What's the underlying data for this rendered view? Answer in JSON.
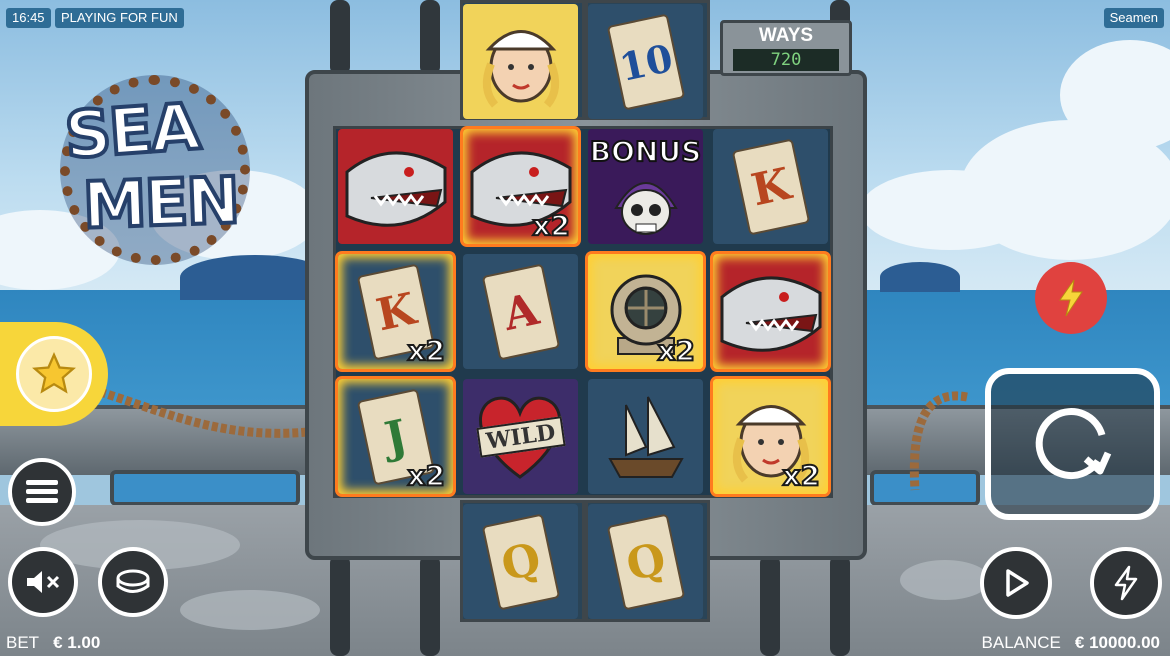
{
  "topbar": {
    "time": "16:45",
    "mode": "PLAYING FOR FUN",
    "game_name": "Seamen"
  },
  "logo": {
    "line1": "SEA",
    "line2": "MEN"
  },
  "ways": {
    "label": "WAYS",
    "value": "720"
  },
  "reels": {
    "top_row": [
      {
        "symbol": "sailor-girl"
      },
      {
        "symbol": "card",
        "text": "10",
        "color": "#1f4f9a"
      }
    ],
    "rows": [
      [
        {
          "symbol": "shark"
        },
        {
          "symbol": "shark",
          "win": true,
          "multiplier": "x2"
        },
        {
          "symbol": "bonus",
          "text": "BONUS"
        },
        {
          "symbol": "card",
          "text": "K",
          "color": "#b8461f"
        }
      ],
      [
        {
          "symbol": "card",
          "text": "K",
          "color": "#b8461f",
          "win": true,
          "multiplier": "x2"
        },
        {
          "symbol": "card",
          "text": "A",
          "color": "#b02a2a"
        },
        {
          "symbol": "diving-helmet",
          "win": true,
          "multiplier": "x2"
        },
        {
          "symbol": "shark",
          "win": true
        }
      ],
      [
        {
          "symbol": "card",
          "text": "J",
          "color": "#2f7a37",
          "win": true,
          "multiplier": "x2"
        },
        {
          "symbol": "wild-heart",
          "text": "WILD"
        },
        {
          "symbol": "ship"
        },
        {
          "symbol": "sailor-girl",
          "win": true,
          "multiplier": "x2"
        }
      ]
    ],
    "bottom_row": [
      {
        "symbol": "card",
        "text": "Q",
        "color": "#c9981b"
      },
      {
        "symbol": "card",
        "text": "Q",
        "color": "#c9981b"
      }
    ]
  },
  "controls": {
    "menu_icon": "hamburger-icon",
    "sound_icon": "sound-muted-icon",
    "coin_icon": "coin-stack-icon",
    "spin_icon": "spin-arrow-icon",
    "autoplay_icon": "play-icon",
    "turbo_icon": "lightning-icon",
    "favorite_icon": "star-icon",
    "boost_icon": "lightning-icon"
  },
  "footer": {
    "bet_label": "BET",
    "bet_value": "€ 1.00",
    "balance_label": "BALANCE",
    "balance_value": "€ 10000.00"
  },
  "colors": {
    "accent_red": "#e0423f",
    "accent_yellow": "#f7d63a",
    "topbar_pill": "#2f6d96",
    "win_glow": "#ff7b1f"
  }
}
